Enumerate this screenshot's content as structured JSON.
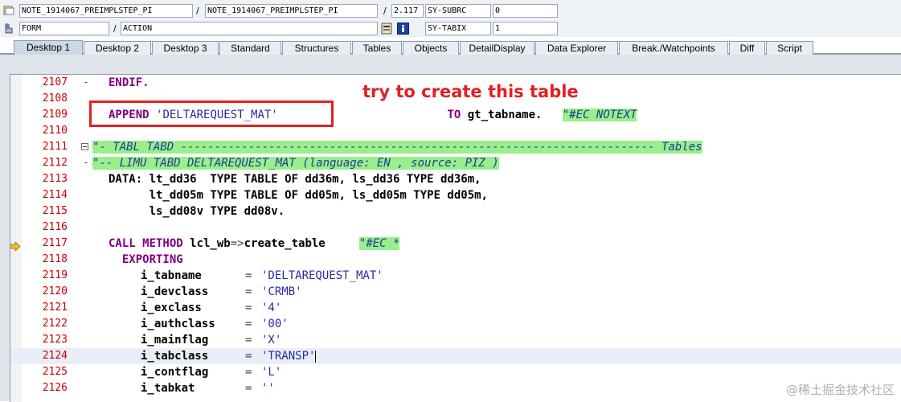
{
  "header": {
    "row1": {
      "program": "NOTE_1914067_PREIMPLSTEP_PI",
      "include": "NOTE_1914067_PREIMPLSTEP_PI",
      "line": "2.117",
      "field_name": "SY-SUBRC",
      "field_value": "0"
    },
    "row2": {
      "event_type": "FORM",
      "event_name": "ACTION",
      "field_name": "SY-TABIX",
      "field_value": "1"
    }
  },
  "tabs": [
    {
      "label": "Desktop 1",
      "active": true
    },
    {
      "label": "Desktop 2"
    },
    {
      "label": "Desktop 3"
    },
    {
      "label": "Standard"
    },
    {
      "label": "Structures"
    },
    {
      "label": "Tables"
    },
    {
      "label": "Objects"
    },
    {
      "label": "DetailDisplay"
    },
    {
      "label": "Data Explorer"
    },
    {
      "label": "Break./Watchpoints"
    },
    {
      "label": "Diff"
    },
    {
      "label": "Script"
    }
  ],
  "editor": {
    "annotation": "try to create this table",
    "current_line": "2117",
    "lines": [
      {
        "num": "2107",
        "marker": "-",
        "code": "ENDIF."
      },
      {
        "num": "2108",
        "code": ""
      },
      {
        "num": "2109",
        "code_parts": [
          "APPEND",
          " ",
          "'DELTAREQUEST_MAT'",
          "                         ",
          "TO",
          " gt_tabname.   ",
          "\"#EC NOTEXT"
        ]
      },
      {
        "num": "2110",
        "code": ""
      },
      {
        "num": "2111",
        "comment": "\"- TABL TABD ---------------------------------------------------------------------- Tables"
      },
      {
        "num": "2112",
        "marker": "-",
        "comment": "\"-- LIMU TABD DELTAREQUEST_MAT (language: EN , source: PIZ )"
      },
      {
        "num": "2113",
        "code": "DATA: lt_dd36  TYPE TABLE OF dd36m, ls_dd36 TYPE dd36m,"
      },
      {
        "num": "2114",
        "code": "      lt_dd05m TYPE TABLE OF dd05m, ls_dd05m TYPE dd05m,"
      },
      {
        "num": "2115",
        "code": "      ls_dd08v TYPE dd08v."
      },
      {
        "num": "2116",
        "code": ""
      },
      {
        "num": "2117",
        "code": "CALL METHOD lcl_wb=>create_table     ",
        "comment": "\"#EC *"
      },
      {
        "num": "2118",
        "code": "  EXPORTING"
      },
      {
        "num": "2119",
        "param": "i_tabname",
        "value": "'DELTAREQUEST_MAT'"
      },
      {
        "num": "2120",
        "param": "i_devclass",
        "value": "'CRMB'"
      },
      {
        "num": "2121",
        "param": "i_exclass",
        "value": "'4'"
      },
      {
        "num": "2122",
        "param": "i_authclass",
        "value": "'00'"
      },
      {
        "num": "2123",
        "param": "i_mainflag",
        "value": "'X'"
      },
      {
        "num": "2124",
        "param": "i_tabclass",
        "value": "'TRANSP'"
      },
      {
        "num": "2125",
        "param": "i_contflag",
        "value": "'L'"
      },
      {
        "num": "2126",
        "param": "i_tabkat",
        "value": "''"
      }
    ]
  },
  "watermark": "@稀土掘金技术社区",
  "colors": {
    "line_numbers": "#cc0000",
    "keyword": "#800080",
    "comment_bg": "#98ef8c",
    "annotation": "#e02020"
  }
}
